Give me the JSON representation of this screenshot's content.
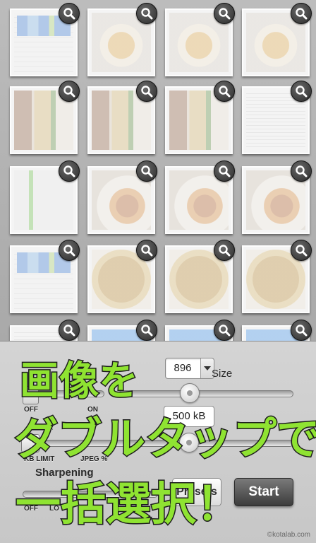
{
  "grid": {
    "tiles": [
      {
        "kind": "stats-screen"
      },
      {
        "kind": "food-photo"
      },
      {
        "kind": "food-photo"
      },
      {
        "kind": "food-photo"
      },
      {
        "kind": "bento-photo"
      },
      {
        "kind": "bento-photo"
      },
      {
        "kind": "bento-photo"
      },
      {
        "kind": "document-scan"
      },
      {
        "kind": "phone-screen"
      },
      {
        "kind": "plate-photo"
      },
      {
        "kind": "plate-photo"
      },
      {
        "kind": "plate-photo"
      },
      {
        "kind": "stats-screen"
      },
      {
        "kind": "noodle-photo"
      },
      {
        "kind": "noodle-photo"
      },
      {
        "kind": "noodle-photo"
      },
      {
        "kind": "document-scan"
      },
      {
        "kind": "app-screen"
      },
      {
        "kind": "app-screen"
      },
      {
        "kind": "app-screen"
      }
    ],
    "zoom_icon": "magnifier-icon"
  },
  "settings": {
    "size_value": "896",
    "size_label": "Size",
    "toggle_off": "OFF",
    "toggle_on": "ON",
    "limit_value": "500 kB",
    "kb_limit": "KB LIMIT",
    "jpeg_pct": "JPEG %",
    "sharpening": "Sharpening",
    "sharp_off": "OFF",
    "sharp_low": "LO",
    "presets": "Presets",
    "start": "Start",
    "credit": "©kotalab.com"
  },
  "overlay": {
    "line1": "画像を",
    "line2": "ダブルタップで",
    "line3": "一括選択！"
  },
  "colors": {
    "caption_green": "#8fe332",
    "caption_outline": "#1d1d1d"
  }
}
